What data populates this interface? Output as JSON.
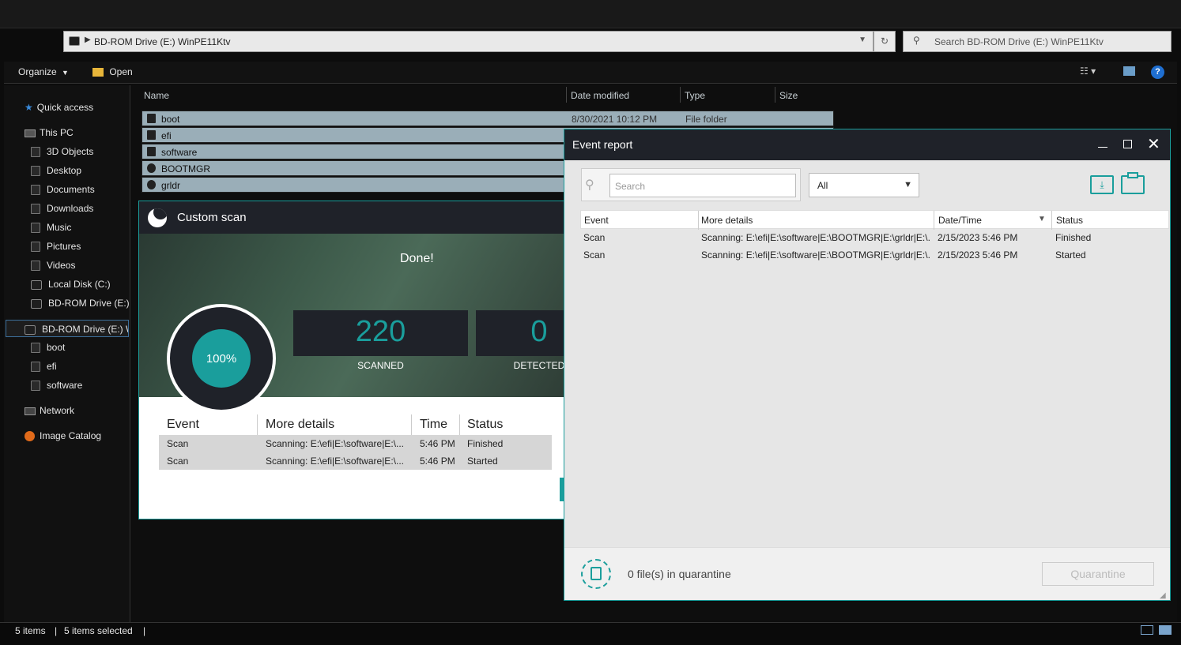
{
  "explorer": {
    "address": "BD-ROM Drive (E:) WinPE11Ktv",
    "search_placeholder": "Search BD-ROM Drive (E:) WinPE11Ktv",
    "toolbar": {
      "organize": "Organize",
      "open": "Open"
    },
    "columns": {
      "name": "Name",
      "date": "Date modified",
      "type": "Type",
      "size": "Size"
    },
    "files": [
      {
        "name": "boot",
        "date": "8/30/2021 10:12 PM",
        "type": "File folder"
      },
      {
        "name": "efi"
      },
      {
        "name": "software"
      },
      {
        "name": "BOOTMGR"
      },
      {
        "name": "grldr"
      }
    ],
    "nav": {
      "quick_access": "Quick access",
      "this_pc": "This PC",
      "items": [
        "3D Objects",
        "Desktop",
        "Documents",
        "Downloads",
        "Music",
        "Pictures",
        "Videos",
        "Local Disk (C:)",
        "BD-ROM Drive (E:) \\"
      ],
      "drive": "BD-ROM Drive (E:) W",
      "drive_children": [
        "boot",
        "efi",
        "software"
      ],
      "network": "Network",
      "image_catalog": "Image Catalog"
    },
    "status": {
      "items": "5 items",
      "selected": "5 items selected"
    }
  },
  "custom_scan": {
    "title": "Custom scan",
    "done": "Done!",
    "progress": "100%",
    "scanned_value": "220",
    "scanned_label": "SCANNED",
    "detected_value": "0",
    "detected_label": "DETECTED",
    "columns": {
      "event": "Event",
      "details": "More details",
      "time": "Time",
      "status": "Status"
    },
    "rows": [
      {
        "event": "Scan",
        "details": "Scanning: E:\\efi|E:\\software|E:\\...",
        "time": "5:46 PM",
        "status": "Finished"
      },
      {
        "event": "Scan",
        "details": "Scanning: E:\\efi|E:\\software|E:\\...",
        "time": "5:46 PM",
        "status": "Started"
      }
    ]
  },
  "event_report": {
    "title": "Event report",
    "search_placeholder": "Search",
    "filter": "All",
    "columns": {
      "event": "Event",
      "details": "More details",
      "datetime": "Date/Time",
      "status": "Status"
    },
    "rows": [
      {
        "event": "Scan",
        "details": "Scanning: E:\\efi|E:\\software|E:\\BOOTMGR|E:\\grldr|E:\\...",
        "datetime": "2/15/2023 5:46 PM",
        "status": "Finished"
      },
      {
        "event": "Scan",
        "details": "Scanning: E:\\efi|E:\\software|E:\\BOOTMGR|E:\\grldr|E:\\...",
        "datetime": "2/15/2023 5:46 PM",
        "status": "Started"
      }
    ],
    "quarantine_count": "0 file(s) in quarantine",
    "quarantine_button": "Quarantine"
  },
  "colors": {
    "accent": "#1a9e9c",
    "dark": "#1f2229",
    "panel": "#e6e6e6"
  }
}
